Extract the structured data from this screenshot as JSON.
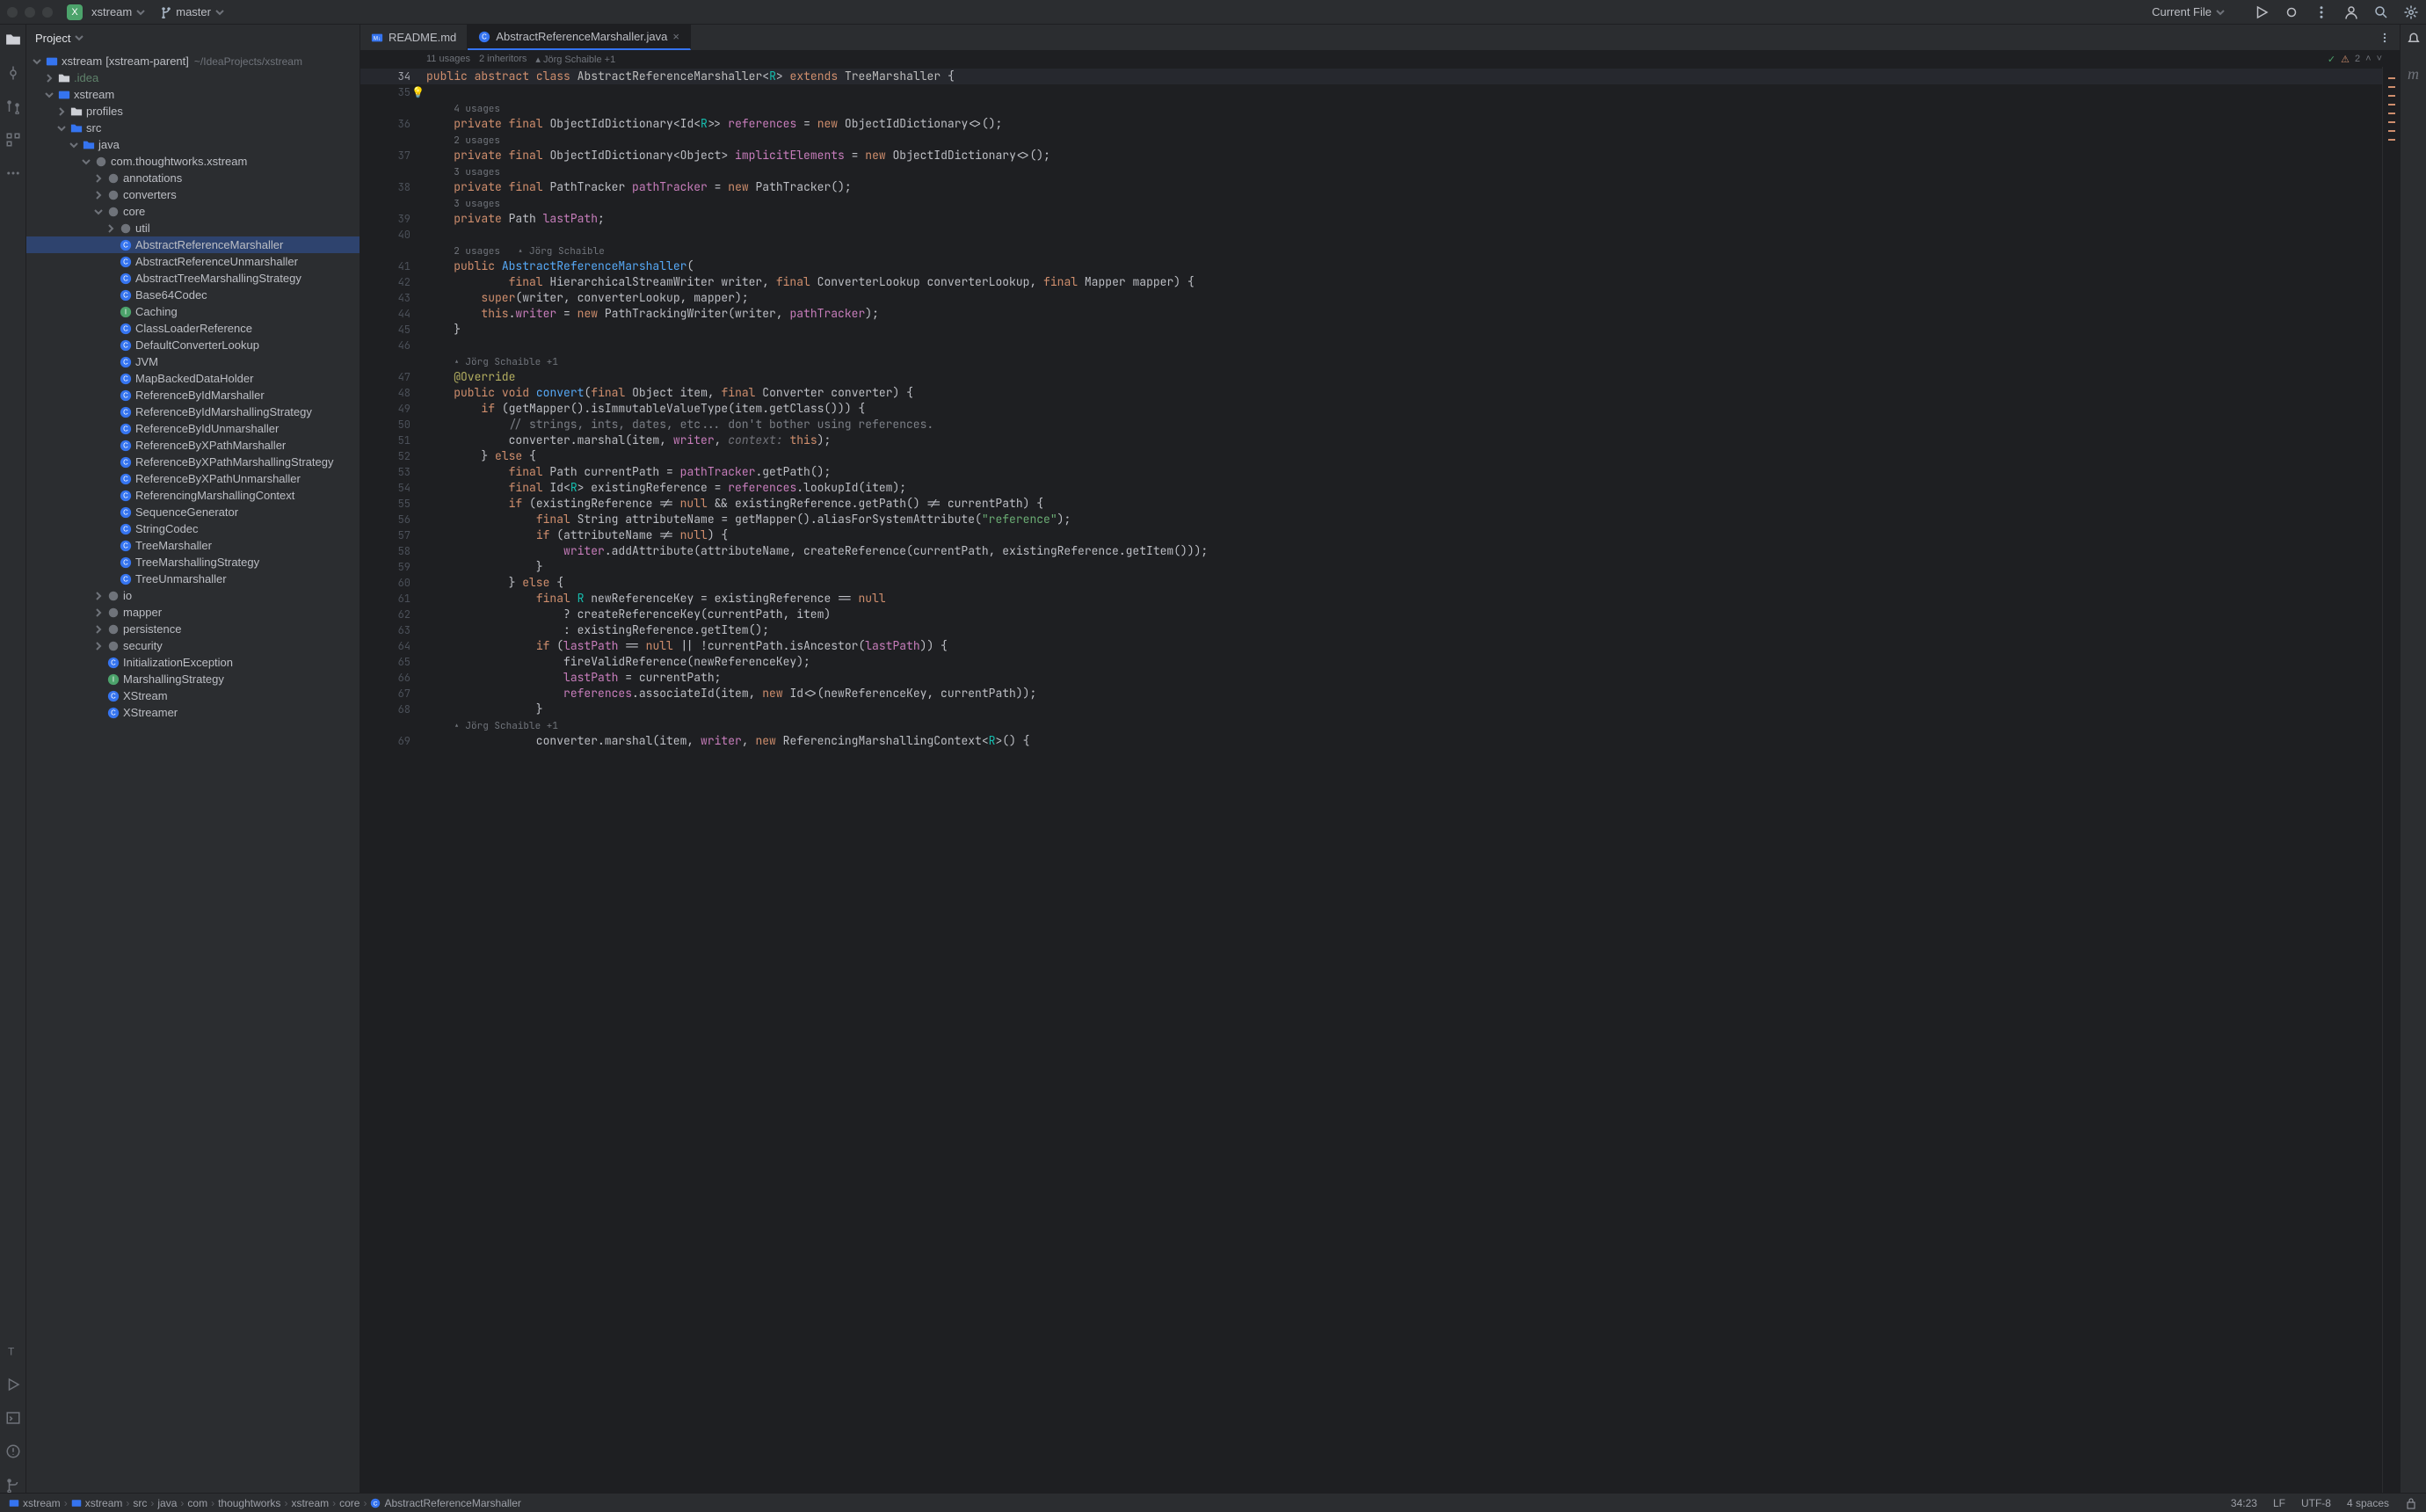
{
  "titlebar": {
    "project_badge": "X",
    "project_name": "xstream",
    "branch": "master",
    "run_config": "Current File"
  },
  "project_panel": {
    "title": "Project",
    "root_name": "xstream",
    "root_qualifier": "[xstream-parent]",
    "root_path": "~/IdeaProjects/xstream",
    "tree": [
      {
        "depth": 0,
        "arrow": "down",
        "icon": "module",
        "label": "xstream",
        "qualifier": "[xstream-parent]",
        "hint": "~/IdeaProjects/xstream"
      },
      {
        "depth": 1,
        "arrow": "right",
        "icon": "folder",
        "label": ".idea",
        "dim": true
      },
      {
        "depth": 1,
        "arrow": "down",
        "icon": "module",
        "label": "xstream"
      },
      {
        "depth": 2,
        "arrow": "right",
        "icon": "folder",
        "label": "profiles"
      },
      {
        "depth": 2,
        "arrow": "down",
        "icon": "source",
        "label": "src"
      },
      {
        "depth": 3,
        "arrow": "down",
        "icon": "source",
        "label": "java"
      },
      {
        "depth": 4,
        "arrow": "down",
        "icon": "package",
        "label": "com.thoughtworks.xstream"
      },
      {
        "depth": 5,
        "arrow": "right",
        "icon": "package",
        "label": "annotations"
      },
      {
        "depth": 5,
        "arrow": "right",
        "icon": "package",
        "label": "converters"
      },
      {
        "depth": 5,
        "arrow": "down",
        "icon": "package",
        "label": "core"
      },
      {
        "depth": 6,
        "arrow": "right",
        "icon": "package",
        "label": "util"
      },
      {
        "depth": 6,
        "arrow": "none",
        "icon": "class",
        "label": "AbstractReferenceMarshaller",
        "selected": true
      },
      {
        "depth": 6,
        "arrow": "none",
        "icon": "class",
        "label": "AbstractReferenceUnmarshaller"
      },
      {
        "depth": 6,
        "arrow": "none",
        "icon": "class",
        "label": "AbstractTreeMarshallingStrategy"
      },
      {
        "depth": 6,
        "arrow": "none",
        "icon": "class",
        "label": "Base64Codec"
      },
      {
        "depth": 6,
        "arrow": "none",
        "icon": "interface",
        "label": "Caching"
      },
      {
        "depth": 6,
        "arrow": "none",
        "icon": "class",
        "label": "ClassLoaderReference"
      },
      {
        "depth": 6,
        "arrow": "none",
        "icon": "class",
        "label": "DefaultConverterLookup"
      },
      {
        "depth": 6,
        "arrow": "none",
        "icon": "class",
        "label": "JVM"
      },
      {
        "depth": 6,
        "arrow": "none",
        "icon": "class",
        "label": "MapBackedDataHolder"
      },
      {
        "depth": 6,
        "arrow": "none",
        "icon": "class",
        "label": "ReferenceByIdMarshaller"
      },
      {
        "depth": 6,
        "arrow": "none",
        "icon": "class",
        "label": "ReferenceByIdMarshallingStrategy"
      },
      {
        "depth": 6,
        "arrow": "none",
        "icon": "class",
        "label": "ReferenceByIdUnmarshaller"
      },
      {
        "depth": 6,
        "arrow": "none",
        "icon": "class",
        "label": "ReferenceByXPathMarshaller"
      },
      {
        "depth": 6,
        "arrow": "none",
        "icon": "class",
        "label": "ReferenceByXPathMarshallingStrategy"
      },
      {
        "depth": 6,
        "arrow": "none",
        "icon": "class",
        "label": "ReferenceByXPathUnmarshaller"
      },
      {
        "depth": 6,
        "arrow": "none",
        "icon": "class",
        "label": "ReferencingMarshallingContext"
      },
      {
        "depth": 6,
        "arrow": "none",
        "icon": "class",
        "label": "SequenceGenerator"
      },
      {
        "depth": 6,
        "arrow": "none",
        "icon": "class",
        "label": "StringCodec"
      },
      {
        "depth": 6,
        "arrow": "none",
        "icon": "class",
        "label": "TreeMarshaller"
      },
      {
        "depth": 6,
        "arrow": "none",
        "icon": "class",
        "label": "TreeMarshallingStrategy"
      },
      {
        "depth": 6,
        "arrow": "none",
        "icon": "class",
        "label": "TreeUnmarshaller"
      },
      {
        "depth": 5,
        "arrow": "right",
        "icon": "package",
        "label": "io"
      },
      {
        "depth": 5,
        "arrow": "right",
        "icon": "package",
        "label": "mapper"
      },
      {
        "depth": 5,
        "arrow": "right",
        "icon": "package",
        "label": "persistence"
      },
      {
        "depth": 5,
        "arrow": "right",
        "icon": "package",
        "label": "security"
      },
      {
        "depth": 5,
        "arrow": "none",
        "icon": "class",
        "label": "InitializationException"
      },
      {
        "depth": 5,
        "arrow": "none",
        "icon": "interface",
        "label": "MarshallingStrategy"
      },
      {
        "depth": 5,
        "arrow": "none",
        "icon": "class",
        "label": "XStream"
      },
      {
        "depth": 5,
        "arrow": "none",
        "icon": "class",
        "label": "XStreamer"
      }
    ]
  },
  "tabs": [
    {
      "icon": "md",
      "label": "README.md",
      "active": false
    },
    {
      "icon": "class",
      "label": "AbstractReferenceMarshaller.java",
      "active": true
    }
  ],
  "editor_header": {
    "usages": "11 usages",
    "inheritors": "2 inheritors",
    "author": "Jörg Schaible +1"
  },
  "inspections": {
    "warnings": "2"
  },
  "code_lines": [
    {
      "n": 34,
      "hl": true,
      "html": "<span class='kw'>public</span> <span class='kw'>abstract</span> <span class='kw'>class</span> <span class='cls'>AbstractReferenceMarshaller</span>&lt;<span class='generic'>R</span>&gt; <span class='kw'>extends</span> <span class='cls'>TreeMarshaller</span> {"
    },
    {
      "n": 35,
      "bulb": true,
      "html": ""
    },
    {
      "hint": "4 usages"
    },
    {
      "n": 36,
      "html": "    <span class='kw'>private</span> <span class='kw'>final</span> ObjectIdDictionary&lt;Id&lt;<span class='generic'>R</span>&gt;&gt; <span class='fld'>references</span> = <span class='kw'>new</span> ObjectIdDictionary&lt;&gt;();"
    },
    {
      "hint": "2 usages"
    },
    {
      "n": 37,
      "html": "    <span class='kw'>private</span> <span class='kw'>final</span> ObjectIdDictionary&lt;Object&gt; <span class='fld'>implicitElements</span> = <span class='kw'>new</span> ObjectIdDictionary&lt;&gt;();"
    },
    {
      "hint": "3 usages"
    },
    {
      "n": 38,
      "html": "    <span class='kw'>private</span> <span class='kw'>final</span> PathTracker <span class='fld'>pathTracker</span> = <span class='kw'>new</span> PathTracker();"
    },
    {
      "hint": "3 usages"
    },
    {
      "n": 39,
      "html": "    <span class='kw'>private</span> Path <span class='fld'>lastPath</span>;"
    },
    {
      "n": 40,
      "html": ""
    },
    {
      "hint": "2 usages   ▴ Jörg Schaible"
    },
    {
      "n": 41,
      "html": "    <span class='kw'>public</span> <span class='fn'>AbstractReferenceMarshaller</span>("
    },
    {
      "n": 42,
      "html": "            <span class='kw'>final</span> HierarchicalStreamWriter writer, <span class='kw'>final</span> ConverterLookup converterLookup, <span class='kw'>final</span> Mapper mapper) {"
    },
    {
      "n": 43,
      "html": "        <span class='kw'>super</span>(writer, converterLookup, mapper);"
    },
    {
      "n": 44,
      "html": "        <span class='kw'>this</span>.<span class='fld'>writer</span> = <span class='kw'>new</span> PathTrackingWriter(writer, <span class='fld'>pathTracker</span>);"
    },
    {
      "n": 45,
      "html": "    }"
    },
    {
      "n": 46,
      "html": ""
    },
    {
      "hint": "▴ Jörg Schaible +1"
    },
    {
      "n": 47,
      "html": "    <span class='ann'>@Override</span>"
    },
    {
      "n": 48,
      "html": "    <span class='kw'>public</span> <span class='kw'>void</span> <span class='fn'>convert</span>(<span class='kw'>final</span> Object item, <span class='kw'>final</span> Converter converter) {"
    },
    {
      "n": 49,
      "html": "        <span class='kw'>if</span> (getMapper().isImmutableValueType(item.getClass())) {"
    },
    {
      "n": 50,
      "html": "            <span class='cmt'>// strings, ints, dates, etc... don't bother using references.</span>"
    },
    {
      "n": 51,
      "html": "            converter.marshal(item, <span class='fld'>writer</span>, <span class='param'>context:</span> <span class='kw'>this</span>);"
    },
    {
      "n": 52,
      "html": "        } <span class='kw'>else</span> {"
    },
    {
      "n": 53,
      "html": "            <span class='kw'>final</span> Path currentPath = <span class='fld'>pathTracker</span>.getPath();"
    },
    {
      "n": 54,
      "html": "            <span class='kw'>final</span> Id&lt;<span class='generic'>R</span>&gt; existingReference = <span class='fld'>references</span>.lookupId(item);"
    },
    {
      "n": 55,
      "html": "            <span class='kw'>if</span> (existingReference != <span class='kw'>null</span> && existingReference.getPath() != currentPath) {"
    },
    {
      "n": 56,
      "html": "                <span class='kw'>final</span> String attributeName = getMapper().aliasForSystemAttribute(<span class='str'>\"reference\"</span>);"
    },
    {
      "n": 57,
      "html": "                <span class='kw'>if</span> (attributeName != <span class='kw'>null</span>) {"
    },
    {
      "n": 58,
      "html": "                    <span class='fld'>writer</span>.addAttribute(attributeName, createReference(currentPath, existingReference.getItem()));"
    },
    {
      "n": 59,
      "html": "                }"
    },
    {
      "n": 60,
      "html": "            } <span class='kw'>else</span> {"
    },
    {
      "n": 61,
      "html": "                <span class='kw'>final</span> <span class='generic'>R</span> newReferenceKey = existingReference == <span class='kw'>null</span>"
    },
    {
      "n": 62,
      "html": "                    ? createReferenceKey(currentPath, item)"
    },
    {
      "n": 63,
      "html": "                    : existingReference.getItem();"
    },
    {
      "n": 64,
      "html": "                <span class='kw'>if</span> (<span class='fld'>lastPath</span> == <span class='kw'>null</span> || !currentPath.isAncestor(<span class='fld'>lastPath</span>)) {"
    },
    {
      "n": 65,
      "html": "                    fireValidReference(newReferenceKey);"
    },
    {
      "n": 66,
      "html": "                    <span class='fld'>lastPath</span> = currentPath;"
    },
    {
      "n": 67,
      "html": "                    <span class='fld'>references</span>.associateId(item, <span class='kw'>new</span> Id&lt;&gt;(newReferenceKey, currentPath));"
    },
    {
      "n": 68,
      "html": "                }"
    },
    {
      "hint": "▴ Jörg Schaible +1"
    },
    {
      "n": 69,
      "html": "                converter.marshal(item, <span class='fld'>writer</span>, <span class='kw'>new</span> ReferencingMarshallingContext&lt;<span class='generic'>R</span>&gt;() {"
    }
  ],
  "breadcrumbs": [
    {
      "icon": "module",
      "label": "xstream"
    },
    {
      "icon": "module",
      "label": "xstream"
    },
    {
      "label": "src"
    },
    {
      "label": "java"
    },
    {
      "label": "com"
    },
    {
      "label": "thoughtworks"
    },
    {
      "label": "xstream"
    },
    {
      "label": "core"
    },
    {
      "icon": "class",
      "label": "AbstractReferenceMarshaller"
    }
  ],
  "status": {
    "position": "34:23",
    "line_sep": "LF",
    "encoding": "UTF-8",
    "indent": "4 spaces"
  }
}
